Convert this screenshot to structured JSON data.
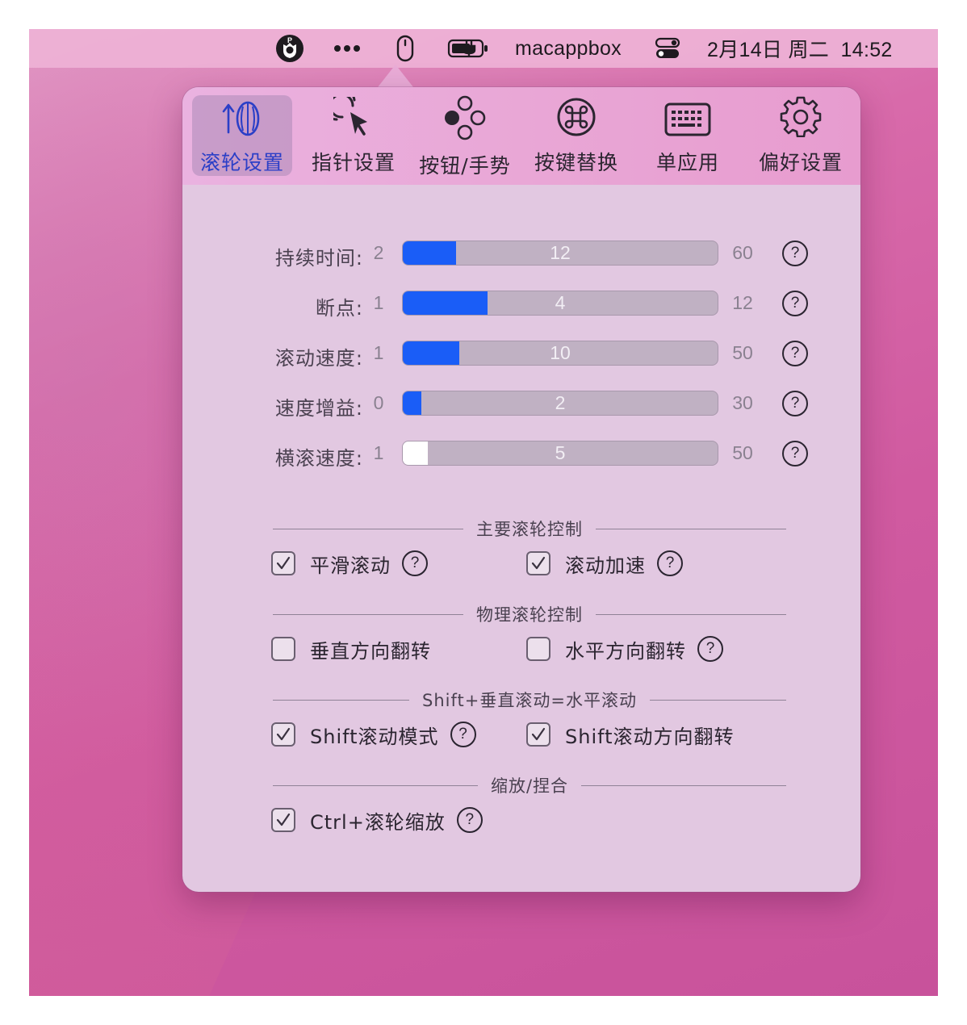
{
  "menubar": {
    "app_name": "macappbox",
    "datetime": "2月14日 周二  14:52",
    "icons": [
      "p-shield-icon",
      "more-dots-icon",
      "mouse-icon",
      "battery-charging-icon",
      "control-center-icon"
    ]
  },
  "tabs": [
    {
      "label": "滚轮设置",
      "icon": "scroll-wheel-icon",
      "selected": true
    },
    {
      "label": "指针设置",
      "icon": "pointer-click-icon",
      "selected": false
    },
    {
      "label": "按钮/手势",
      "icon": "buttons-gesture-icon",
      "selected": false
    },
    {
      "label": "按键替换",
      "icon": "command-key-icon",
      "selected": false
    },
    {
      "label": "单应用",
      "icon": "keyboard-icon",
      "selected": false
    },
    {
      "label": "偏好设置",
      "icon": "gear-icon",
      "selected": false
    }
  ],
  "sliders": [
    {
      "label": "持续时间:",
      "min": "2",
      "value": "12",
      "max": "60",
      "fill_fraction": 0.17,
      "accent": "#1a5df7"
    },
    {
      "label": "断点:",
      "min": "1",
      "value": "4",
      "max": "12",
      "fill_fraction": 0.27,
      "accent": "#1a5df7"
    },
    {
      "label": "滚动速度:",
      "min": "1",
      "value": "10",
      "max": "50",
      "fill_fraction": 0.18,
      "accent": "#1a5df7"
    },
    {
      "label": "速度增益:",
      "min": "0",
      "value": "2",
      "max": "30",
      "fill_fraction": 0.06,
      "accent": "#1a5df7"
    },
    {
      "label": "横滚速度:",
      "min": "1",
      "value": "5",
      "max": "50",
      "fill_fraction": 0.08,
      "accent": "#ffffff"
    }
  ],
  "help_glyph": "?",
  "sections": [
    {
      "title": "主要滚轮控制",
      "options": [
        {
          "label": "平滑滚动",
          "checked": true,
          "help": true
        },
        {
          "label": "滚动加速",
          "checked": true,
          "help": true
        }
      ]
    },
    {
      "title": "物理滚轮控制",
      "options": [
        {
          "label": "垂直方向翻转",
          "checked": false,
          "help": false
        },
        {
          "label": "水平方向翻转",
          "checked": false,
          "help": true
        }
      ]
    },
    {
      "title": "Shift+垂直滚动=水平滚动",
      "options": [
        {
          "label": "Shift滚动模式",
          "checked": true,
          "help": true
        },
        {
          "label": "Shift滚动方向翻转",
          "checked": true,
          "help": false
        }
      ]
    },
    {
      "title": "缩放/捏合",
      "options": [
        {
          "label": "Ctrl+滚轮缩放",
          "checked": true,
          "help": true
        }
      ]
    }
  ]
}
